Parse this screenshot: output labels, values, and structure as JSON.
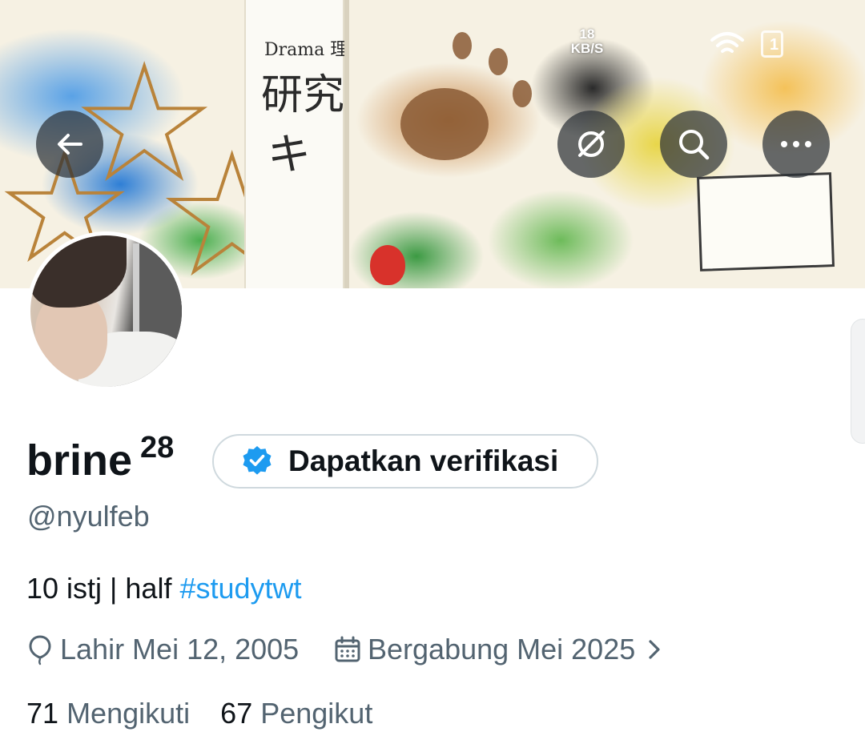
{
  "status_bar": {
    "net_speed_value": "18",
    "net_speed_unit": "KB/S",
    "battery_level": "1"
  },
  "header": {
    "back_icon": "arrow-left-icon",
    "grok_icon": "grok-icon",
    "search_icon": "search-icon",
    "more_icon": "more-horizontal-icon"
  },
  "banner": {
    "book_label": "Drama 理",
    "book_heading_1": "研究",
    "book_heading_2": "キ"
  },
  "profile": {
    "display_name": "brine",
    "name_superscript": "28",
    "verify_label": "Dapatkan verifikasi",
    "handle": "@nyulfeb",
    "bio_text": "10 istj | half ",
    "bio_hashtag": "#studytwt",
    "birth_label": "Lahir Mei 12, 2005",
    "joined_label": "Bergabung Mei 2025",
    "following_count": "71",
    "following_label": "Mengikuti",
    "followers_count": "67",
    "followers_label": "Pengikut"
  },
  "colors": {
    "accent": "#1d9bf0",
    "text_primary": "#0f1419",
    "text_secondary": "#536471",
    "border": "#cfd9de"
  }
}
